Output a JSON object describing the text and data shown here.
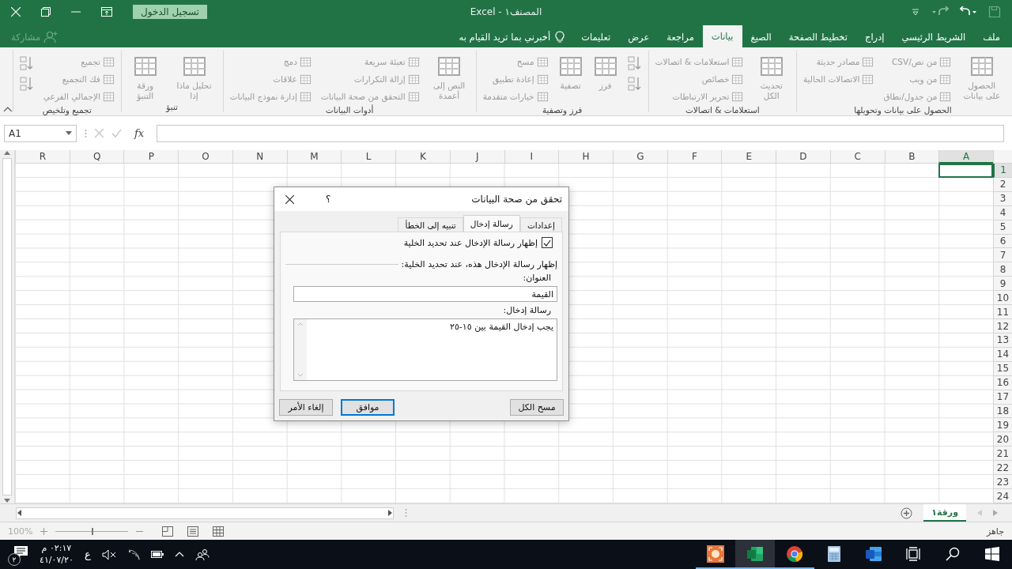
{
  "window": {
    "title": "المصنف١ - Excel",
    "sign_in": "تسجيل الدخول"
  },
  "ribbon_tabs": [
    {
      "label": "ملف",
      "selected": false
    },
    {
      "label": "الشريط الرئيسي",
      "selected": false
    },
    {
      "label": "إدراج",
      "selected": false
    },
    {
      "label": "تخطيط الصفحة",
      "selected": false
    },
    {
      "label": "الصيغ",
      "selected": false
    },
    {
      "label": "بيانات",
      "selected": true
    },
    {
      "label": "مراجعة",
      "selected": false
    },
    {
      "label": "عرض",
      "selected": false
    },
    {
      "label": "تعليمات",
      "selected": false
    }
  ],
  "tell_me": "أخبرني بما تريد القيام به",
  "share": "مشاركة",
  "ribbon": {
    "groups": [
      {
        "label": "الحصول على بيانات وتحويلها",
        "columns": [
          [
            {
              "kind": "large",
              "label": "الحصول على بيانات"
            }
          ],
          [
            {
              "kind": "small",
              "label": "من نص/CSV"
            },
            {
              "kind": "small",
              "label": "من ويب"
            },
            {
              "kind": "small",
              "label": "من جدول/نطاق"
            }
          ],
          [
            {
              "kind": "small",
              "label": "مصادر حديثة"
            },
            {
              "kind": "small",
              "label": "الاتصالات الحالية"
            }
          ]
        ]
      },
      {
        "label": "استعلامات & اتصالات",
        "columns": [
          [
            {
              "kind": "large",
              "label": "تحديث الكل"
            }
          ],
          [
            {
              "kind": "small",
              "label": "استعلامات & اتصالات"
            },
            {
              "kind": "small",
              "label": "خصائص"
            },
            {
              "kind": "small",
              "label": "تحرير الارتباطات"
            }
          ]
        ]
      },
      {
        "label": "فرز وتصفية",
        "columns": [
          [
            {
              "kind": "icon"
            },
            {
              "kind": "icon"
            }
          ],
          [
            {
              "kind": "large",
              "label": "فرز"
            }
          ],
          [
            {
              "kind": "large",
              "label": "تصفية"
            }
          ],
          [
            {
              "kind": "small",
              "label": "مسح"
            },
            {
              "kind": "small",
              "label": "إعادة تطبيق"
            },
            {
              "kind": "small",
              "label": "خيارات متقدمة"
            }
          ]
        ]
      },
      {
        "label": "أدوات البيانات",
        "columns": [
          [
            {
              "kind": "large",
              "label": "النص إلى أعمدة"
            }
          ],
          [
            {
              "kind": "small",
              "label": "تعبئة سريعة"
            },
            {
              "kind": "small",
              "label": "إزالة التكرارات"
            },
            {
              "kind": "small",
              "label": "التحقق من صحة البيانات"
            }
          ],
          [
            {
              "kind": "small",
              "label": "دمج"
            },
            {
              "kind": "small",
              "label": "علاقات"
            },
            {
              "kind": "small",
              "label": "إدارة نموذج البيانات"
            }
          ]
        ]
      },
      {
        "label": "تنبؤ",
        "columns": [
          [
            {
              "kind": "large",
              "label": "تحليل ماذا إذا"
            }
          ],
          [
            {
              "kind": "large",
              "label": "ورقة التنبؤ"
            }
          ]
        ]
      },
      {
        "label": "تجميع وتلخيص",
        "columns": [
          [
            {
              "kind": "small",
              "label": "تجميع"
            },
            {
              "kind": "small",
              "label": "فك التجميع"
            },
            {
              "kind": "small",
              "label": "الإجمالي الفرعي"
            }
          ],
          [
            {
              "kind": "icon"
            },
            {
              "kind": "icon"
            }
          ]
        ]
      }
    ]
  },
  "formula_bar": {
    "name_box": "A1",
    "function_label": "fx"
  },
  "grid": {
    "columns": [
      {
        "label": "A",
        "selected": true
      },
      {
        "label": "B",
        "selected": false
      },
      {
        "label": "C",
        "selected": false
      },
      {
        "label": "D",
        "selected": false
      },
      {
        "label": "E",
        "selected": false
      },
      {
        "label": "F",
        "selected": false
      },
      {
        "label": "G",
        "selected": false
      },
      {
        "label": "H",
        "selected": false
      },
      {
        "label": "I",
        "selected": false
      },
      {
        "label": "J",
        "selected": false
      },
      {
        "label": "K",
        "selected": false
      },
      {
        "label": "L",
        "selected": false
      },
      {
        "label": "M",
        "selected": false
      },
      {
        "label": "N",
        "selected": false
      },
      {
        "label": "O",
        "selected": false
      },
      {
        "label": "P",
        "selected": false
      },
      {
        "label": "Q",
        "selected": false
      },
      {
        "label": "R",
        "selected": false
      }
    ],
    "rows": [
      {
        "label": "1",
        "selected": true
      },
      {
        "label": "2",
        "selected": false
      },
      {
        "label": "3",
        "selected": false
      },
      {
        "label": "4",
        "selected": false
      },
      {
        "label": "5",
        "selected": false
      },
      {
        "label": "6",
        "selected": false
      },
      {
        "label": "7",
        "selected": false
      },
      {
        "label": "8",
        "selected": false
      },
      {
        "label": "9",
        "selected": false
      },
      {
        "label": "10",
        "selected": false
      },
      {
        "label": "11",
        "selected": false
      },
      {
        "label": "12",
        "selected": false
      },
      {
        "label": "13",
        "selected": false
      },
      {
        "label": "14",
        "selected": false
      },
      {
        "label": "15",
        "selected": false
      },
      {
        "label": "16",
        "selected": false
      },
      {
        "label": "17",
        "selected": false
      },
      {
        "label": "18",
        "selected": false
      },
      {
        "label": "19",
        "selected": false
      },
      {
        "label": "20",
        "selected": false
      },
      {
        "label": "21",
        "selected": false
      },
      {
        "label": "22",
        "selected": false
      },
      {
        "label": "23",
        "selected": false
      },
      {
        "label": "24",
        "selected": false
      }
    ]
  },
  "dialog": {
    "title": "تحقق من صحة البيانات",
    "help": "؟",
    "tabs": [
      {
        "label": "إعدادات",
        "selected": false
      },
      {
        "label": "رسالة إدخال",
        "selected": true
      },
      {
        "label": "تنبيه إلى الخطأ",
        "selected": false
      }
    ],
    "show_message": {
      "label": "إظهار رسالة الإدخال عند تحديد الخلية",
      "checked": true
    },
    "section_label": "إظهار رسالة الإدخال هذه، عند تحديد الخلية:",
    "title_label": "العنوان:",
    "title_value": "القيمة",
    "message_label": "رسالة إدخال:",
    "message_value": "يجب إدخال القيمة بين ١٥-٢٥",
    "buttons": [
      {
        "label": "مسح الكل",
        "default": false
      },
      {
        "label": "موافق",
        "default": true
      },
      {
        "label": "إلغاء الأمر",
        "default": false
      }
    ]
  },
  "sheets": [
    {
      "label": "ورقة١",
      "selected": true
    }
  ],
  "status_bar": {
    "ready": "جاهز",
    "zoom": "100%",
    "zoom_slider": {
      "level": 0.5
    }
  },
  "taskbar": {
    "apps": [
      {
        "kind": "start",
        "running": false,
        "selected": false
      },
      {
        "kind": "search",
        "running": false,
        "selected": false
      },
      {
        "kind": "task-view",
        "running": false,
        "selected": false
      },
      {
        "kind": "word",
        "running": false,
        "selected": false
      },
      {
        "kind": "calculator",
        "running": false,
        "selected": false
      },
      {
        "kind": "chrome",
        "running": true,
        "selected": false
      },
      {
        "kind": "excel",
        "running": true,
        "selected": true
      },
      {
        "kind": "recorder",
        "running": true,
        "selected": false
      }
    ],
    "language": "ع",
    "time": "٠٢:١٧ م",
    "date": "٤١/٠٧/٢٠",
    "notification_count": "٢"
  }
}
